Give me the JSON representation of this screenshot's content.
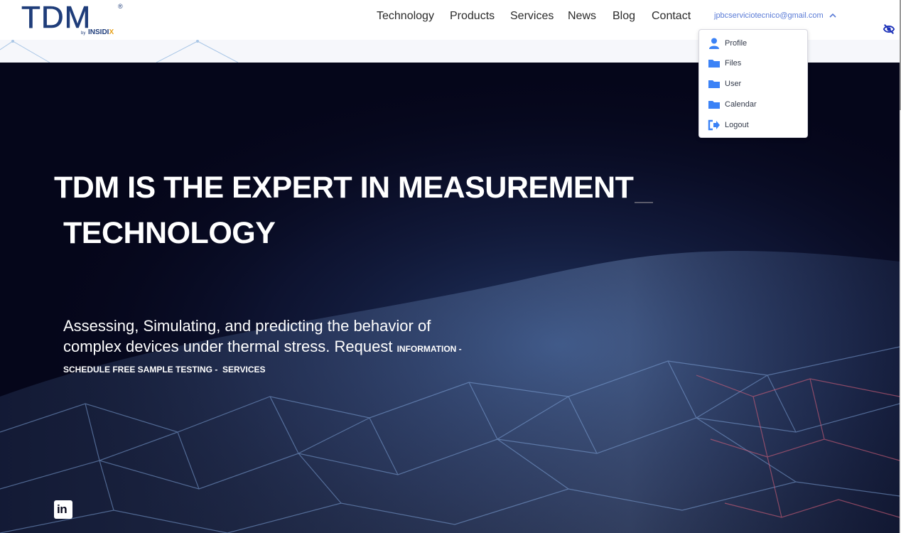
{
  "brand": {
    "name": "TDM",
    "registered": "®",
    "by": "by",
    "sub_prefix": "INSIDI",
    "sub_suffix": "X"
  },
  "nav": {
    "items": [
      "Technology",
      "Products",
      "Services",
      "News",
      "Blog",
      "Contact"
    ],
    "user_email": "jpbcserviciotecnico@gmail.com"
  },
  "dropdown": {
    "items": [
      {
        "label": "Profile",
        "icon": "user-icon"
      },
      {
        "label": "Files",
        "icon": "folder-icon"
      },
      {
        "label": "User",
        "icon": "folder-icon"
      },
      {
        "label": "Calendar",
        "icon": "folder-icon"
      },
      {
        "label": "Logout",
        "icon": "logout-icon"
      }
    ]
  },
  "hero": {
    "title_line1": "TDM IS THE EXPERT IN MEASUREMENT",
    "title_line2": "TECHNOLOGY",
    "subtitle": "Assessing, Simulating, and predicting the behavior of complex devices under thermal stress. Request",
    "link_information": "INFORMATION -",
    "link_schedule": "SCHEDULE FREE SAMPLE TESTING -",
    "link_services": "SERVICES",
    "social": "in"
  },
  "colors": {
    "brand_blue": "#1f3d7a",
    "accent_orange": "#e8a21c",
    "link_blue": "#5a7bd6",
    "hero_bg": "#05061a",
    "icon_blue": "#3b82f6"
  }
}
